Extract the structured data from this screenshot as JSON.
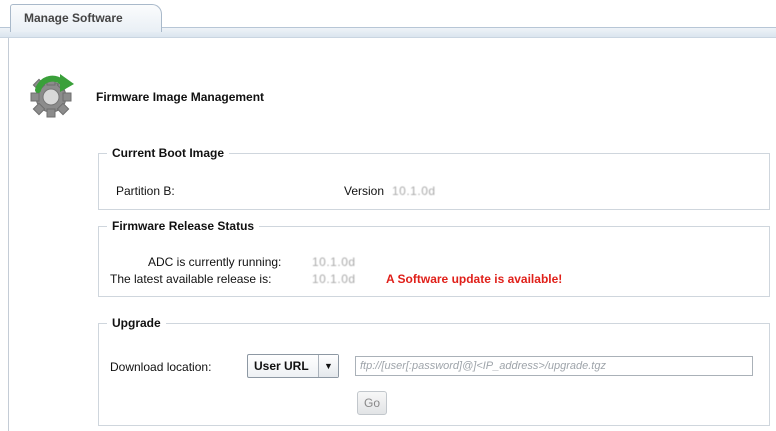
{
  "tabs": [
    {
      "label": "Manage Software",
      "active": true
    }
  ],
  "page": {
    "title": "Firmware Image Management",
    "icon": "gear-refresh-icon"
  },
  "current_boot_image": {
    "legend": "Current Boot Image",
    "partition_label": "Partition B:",
    "version_label": "Version",
    "version_value": "10.1.0d"
  },
  "firmware_release_status": {
    "legend": "Firmware Release Status",
    "running_label": "ADC is currently running:",
    "running_value": "10.1.0d",
    "latest_label": "The latest available release is:",
    "latest_value": "10.1.0d",
    "update_notice": "A Software update is available!"
  },
  "upgrade": {
    "legend": "Upgrade",
    "download_label": "Download location:",
    "download_selected": "User URL",
    "url_placeholder": "ftp://[user[:password]@]<IP_address>/upgrade.tgz",
    "url_value": "",
    "go_label": "Go"
  },
  "colors": {
    "alert": "#e0201a",
    "tab_strip": "#dbe5ef",
    "gear_green": "#3aa03a",
    "gear_gray": "#8c8c8c"
  }
}
